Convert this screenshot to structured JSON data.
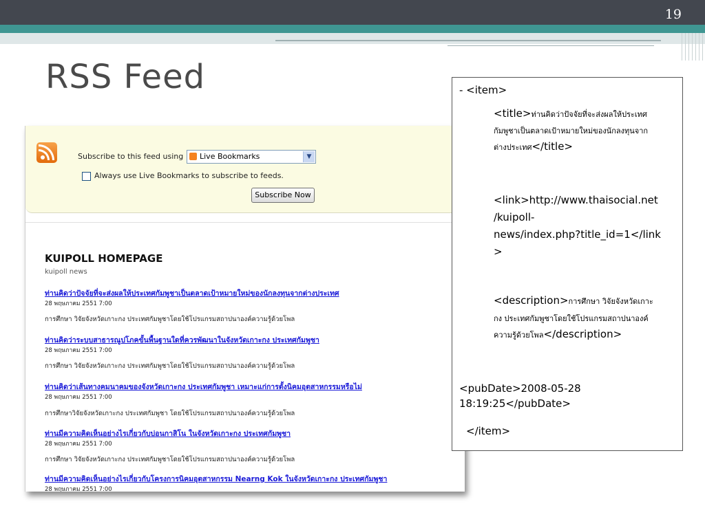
{
  "slide": {
    "number": "19",
    "title": "RSS Feed"
  },
  "feed_page": {
    "subscribe_label": "Subscribe to this feed using",
    "reader_selected": "Live Bookmarks",
    "always_use_label": "Always use Live Bookmarks to subscribe to feeds.",
    "always_use_checked": false,
    "subscribe_button": "Subscribe Now",
    "homepage_title": "KUIPOLL HOMEPAGE",
    "homepage_subtitle": "kuipoll news",
    "items": [
      {
        "title": "ท่านคิดว่าปัจจัยที่จะส่งผลให้ประเทศกัมพูชาเป็นตลาดเป้าหมายใหม่ของนักลงทุนจากต่างประเทศ",
        "date": "28 พฤษภาคม 2551 7:00",
        "desc": "การศึกษา วิจัยจังหวัดเกาะกง ประเทศกัมพูชาโดยใช้โปรแกรมสถาปนาองค์ความรู้ด้วยโพล"
      },
      {
        "title": "ท่านคิดว่าระบบสาธารณูปโภคขั้นพื้นฐานใดที่ควรพัฒนาในจังหวัดเกาะกง ประเทศกัมพูชา",
        "date": "28 พฤษภาคม 2551 7:00",
        "desc": "การศึกษา วิจัยจังหวัดเกาะกง ประเทศกัมพูชาโดยใช้โปรแกรมสถาปนาองค์ความรู้ด้วยโพล"
      },
      {
        "title": "ท่านคิดว่าเส้นทางคมนาคมของจังหวัดเกาะกง ประเทศกัมพูชา เหมาะแก่การตั้งนิคมอุตสาหกรรมหรือไม่",
        "date": "28 พฤษภาคม 2551 7:00",
        "desc": "การศึกษาวิจัยจังหวัดเกาะกง ประเทศกัมพูชา โดยใช้โปรแกรมสถาปนาองค์ความรู้ด้วยโพล"
      },
      {
        "title": "ท่านมีความคิดเห็นอย่างไรเกี่ยวกับบ่อนกาสิโน ในจังหวัดเกาะกง ประเทศกัมพูชา",
        "date": "28 พฤษภาคม 2551 7:00",
        "desc": "การศึกษา วิจัยจังหวัดเกาะกง ประเทศกัมพูชาโดยใช้โปรแกรมสถาปนาองค์ความรู้ด้วยโพล"
      },
      {
        "title": "ท่านมีความคิดเห็นอย่างไรเกี่ยวกับโครงการนิคมอุตสาหกรรม Nearng Kok ในจังหวัดเกาะกง ประเทศกัมพูชา",
        "date": "28 พฤษภาคม 2551 7:00",
        "desc": ""
      }
    ]
  },
  "code_box": {
    "item_open": "- <item>",
    "title_open": "<title>",
    "title_text_1": "ท่านคิดว่าปัจจัยที่จะส่งผลให้ประเทศ",
    "title_text_2": "กัมพูชาเป็นตลาดเป้าหมายใหม่ของนักลงทุนจาก",
    "title_text_3": "ต่างประเทศ",
    "title_close": "</title>",
    "link_1": "<link>http://www.thaisocial.net",
    "link_2": "/kuipoll-",
    "link_3": "news/index.php?title_id=1</link",
    "link_4": ">",
    "desc_open": "<description>",
    "desc_text_1": "การศึกษา วิจัยจังหวัดเกาะ",
    "desc_text_2": "กง ประเทศกัมพูชาโดยใช้โปรแกรมสถาปนาองค์",
    "desc_text_3": "ความรู้ด้วยโพล",
    "desc_close": "</description>",
    "pubdate_1": "<pubDate>2008-05-28",
    "pubdate_2": "18:19:25</pubDate>",
    "item_close": "</item>"
  },
  "colors": {
    "band_dark": "#43474f",
    "band_teal": "#3f9692",
    "link_blue": "#1a1ad8",
    "feed_header_bg": "#fbfbe2",
    "rss_orange": "#e36b0c"
  }
}
